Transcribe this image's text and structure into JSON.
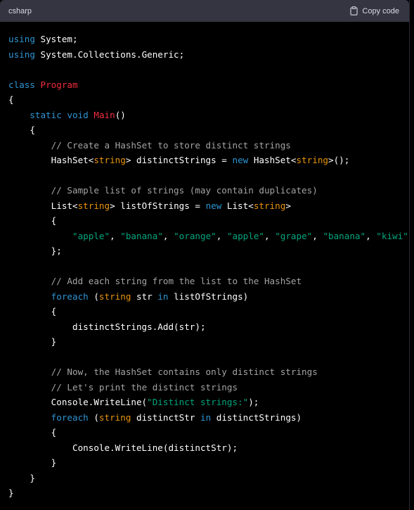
{
  "header": {
    "language": "csharp",
    "copy_label": "Copy code",
    "copy_icon": "clipboard-icon"
  },
  "code_lines": [
    [
      {
        "t": "using",
        "c": "kw"
      },
      {
        "t": " System;",
        "c": "pl"
      }
    ],
    [
      {
        "t": "using",
        "c": "kw"
      },
      {
        "t": " System.Collections.Generic;",
        "c": "pl"
      }
    ],
    [],
    [
      {
        "t": "class",
        "c": "kw"
      },
      {
        "t": " ",
        "c": "pl"
      },
      {
        "t": "Program",
        "c": "ty"
      }
    ],
    [
      {
        "t": "{",
        "c": "pl"
      }
    ],
    [
      {
        "t": "    ",
        "c": "pl"
      },
      {
        "t": "static",
        "c": "kw"
      },
      {
        "t": " ",
        "c": "pl"
      },
      {
        "t": "void",
        "c": "kw"
      },
      {
        "t": " ",
        "c": "pl"
      },
      {
        "t": "Main",
        "c": "ty"
      },
      {
        "t": "()",
        "c": "pl"
      }
    ],
    [
      {
        "t": "    {",
        "c": "pl"
      }
    ],
    [
      {
        "t": "        ",
        "c": "pl"
      },
      {
        "t": "// Create a HashSet to store distinct strings",
        "c": "cm"
      }
    ],
    [
      {
        "t": "        HashSet<",
        "c": "pl"
      },
      {
        "t": "string",
        "c": "gen"
      },
      {
        "t": "> distinctStrings = ",
        "c": "pl"
      },
      {
        "t": "new",
        "c": "kw"
      },
      {
        "t": " HashSet<",
        "c": "pl"
      },
      {
        "t": "string",
        "c": "gen"
      },
      {
        "t": ">();",
        "c": "pl"
      }
    ],
    [],
    [
      {
        "t": "        ",
        "c": "pl"
      },
      {
        "t": "// Sample list of strings (may contain duplicates)",
        "c": "cm"
      }
    ],
    [
      {
        "t": "        List<",
        "c": "pl"
      },
      {
        "t": "string",
        "c": "gen"
      },
      {
        "t": "> listOfStrings = ",
        "c": "pl"
      },
      {
        "t": "new",
        "c": "kw"
      },
      {
        "t": " List<",
        "c": "pl"
      },
      {
        "t": "string",
        "c": "gen"
      },
      {
        "t": ">",
        "c": "pl"
      }
    ],
    [
      {
        "t": "        {",
        "c": "pl"
      }
    ],
    [
      {
        "t": "            ",
        "c": "pl"
      },
      {
        "t": "\"apple\"",
        "c": "str"
      },
      {
        "t": ", ",
        "c": "pl"
      },
      {
        "t": "\"banana\"",
        "c": "str"
      },
      {
        "t": ", ",
        "c": "pl"
      },
      {
        "t": "\"orange\"",
        "c": "str"
      },
      {
        "t": ", ",
        "c": "pl"
      },
      {
        "t": "\"apple\"",
        "c": "str"
      },
      {
        "t": ", ",
        "c": "pl"
      },
      {
        "t": "\"grape\"",
        "c": "str"
      },
      {
        "t": ", ",
        "c": "pl"
      },
      {
        "t": "\"banana\"",
        "c": "str"
      },
      {
        "t": ", ",
        "c": "pl"
      },
      {
        "t": "\"kiwi\"",
        "c": "str"
      }
    ],
    [
      {
        "t": "        };",
        "c": "pl"
      }
    ],
    [],
    [
      {
        "t": "        ",
        "c": "pl"
      },
      {
        "t": "// Add each string from the list to the HashSet",
        "c": "cm"
      }
    ],
    [
      {
        "t": "        ",
        "c": "pl"
      },
      {
        "t": "foreach",
        "c": "kw"
      },
      {
        "t": " (",
        "c": "pl"
      },
      {
        "t": "string",
        "c": "gen"
      },
      {
        "t": " str ",
        "c": "pl"
      },
      {
        "t": "in",
        "c": "kw"
      },
      {
        "t": " listOfStrings)",
        "c": "pl"
      }
    ],
    [
      {
        "t": "        {",
        "c": "pl"
      }
    ],
    [
      {
        "t": "            distinctStrings.Add(str);",
        "c": "pl"
      }
    ],
    [
      {
        "t": "        }",
        "c": "pl"
      }
    ],
    [],
    [
      {
        "t": "        ",
        "c": "pl"
      },
      {
        "t": "// Now, the HashSet contains only distinct strings",
        "c": "cm"
      }
    ],
    [
      {
        "t": "        ",
        "c": "pl"
      },
      {
        "t": "// Let's print the distinct strings",
        "c": "cm"
      }
    ],
    [
      {
        "t": "        Console.WriteLine(",
        "c": "pl"
      },
      {
        "t": "\"Distinct strings:\"",
        "c": "str"
      },
      {
        "t": ");",
        "c": "pl"
      }
    ],
    [
      {
        "t": "        ",
        "c": "pl"
      },
      {
        "t": "foreach",
        "c": "kw"
      },
      {
        "t": " (",
        "c": "pl"
      },
      {
        "t": "string",
        "c": "gen"
      },
      {
        "t": " distinctStr ",
        "c": "pl"
      },
      {
        "t": "in",
        "c": "kw"
      },
      {
        "t": " distinctStrings)",
        "c": "pl"
      }
    ],
    [
      {
        "t": "        {",
        "c": "pl"
      }
    ],
    [
      {
        "t": "            Console.WriteLine(distinctStr);",
        "c": "pl"
      }
    ],
    [
      {
        "t": "        }",
        "c": "pl"
      }
    ],
    [
      {
        "t": "    }",
        "c": "pl"
      }
    ],
    [
      {
        "t": "}",
        "c": "pl"
      }
    ]
  ],
  "colors": {
    "header_bg": "#343541",
    "code_bg": "#000000",
    "keyword": "#2e95d3",
    "type": "#f22c3d",
    "string": "#00a67d",
    "comment": "#a3a3a3",
    "generic": "#e9950c",
    "plain": "#ffffff"
  }
}
